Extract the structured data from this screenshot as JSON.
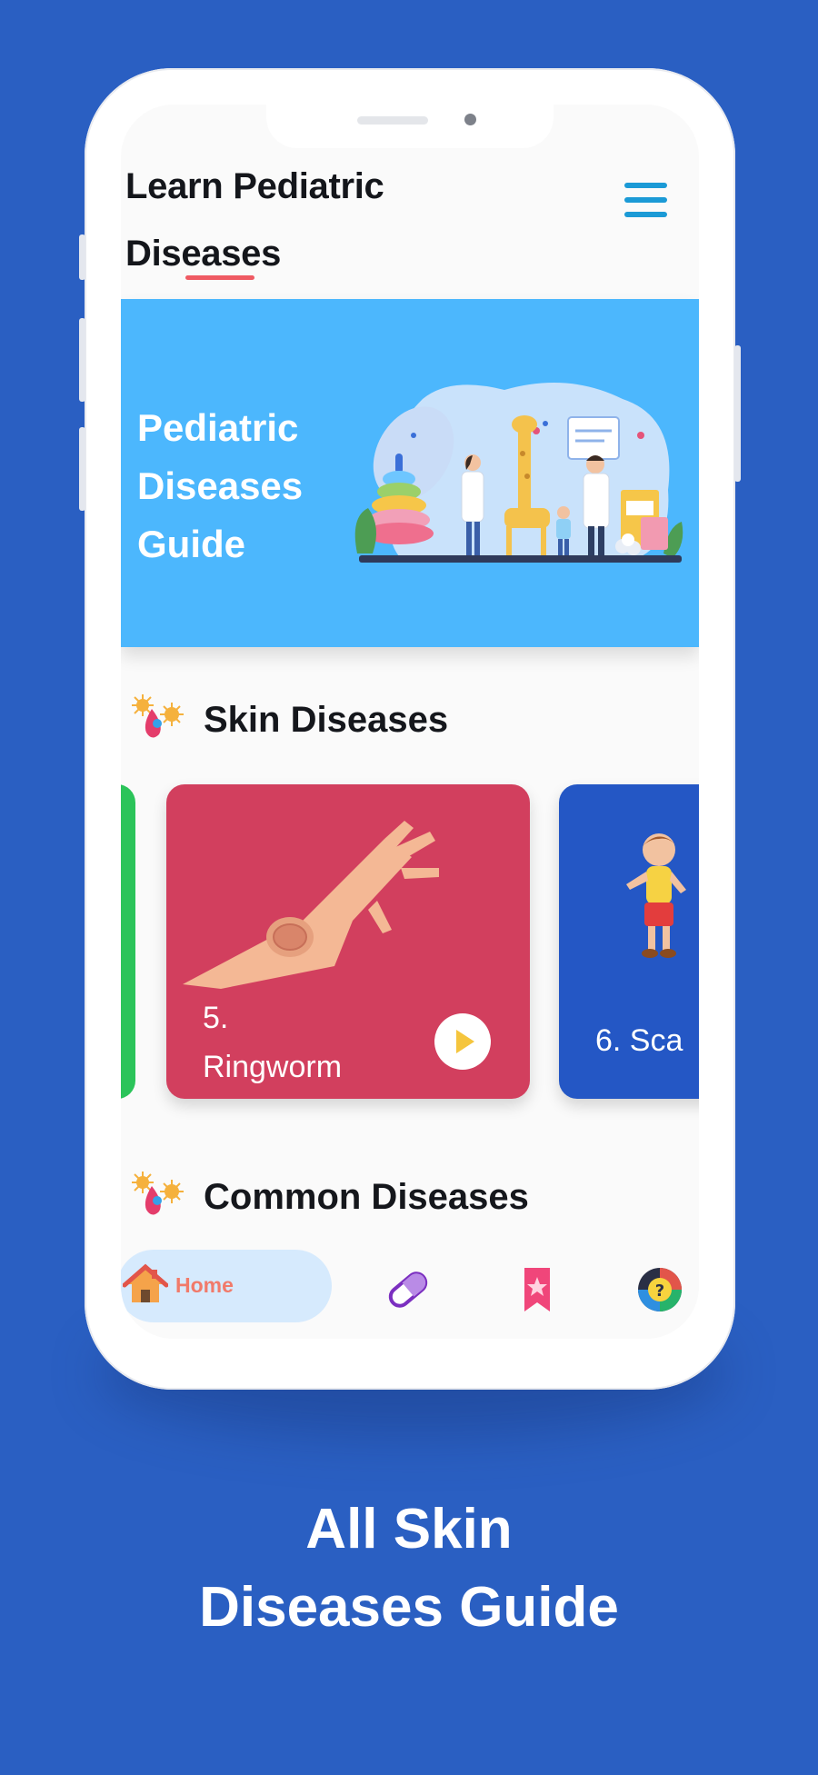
{
  "app": {
    "title": "Learn Pediatric Diseases",
    "title_line1": "Learn Pediatric",
    "title_line2": "Diseases"
  },
  "banner": {
    "line1": "Pediatric",
    "line2": "Diseases",
    "line3": "Guide"
  },
  "sections": [
    {
      "title": "Skin Diseases",
      "cards": [
        {
          "number": "5.",
          "title": "Ringworm",
          "color": "#d23f5e"
        },
        {
          "number": "6.",
          "title": "6. Sca",
          "color": "#2457c5"
        }
      ]
    },
    {
      "title": "Common Diseases"
    }
  ],
  "bottom_nav": {
    "items": [
      {
        "label": "Home",
        "icon": "home-icon",
        "active": true
      },
      {
        "label": "",
        "icon": "pill-icon"
      },
      {
        "label": "",
        "icon": "bookmark-icon"
      },
      {
        "label": "",
        "icon": "quiz-icon"
      }
    ]
  },
  "caption": {
    "line1": "All Skin",
    "line2": "Diseases Guide"
  },
  "colors": {
    "background": "#2a5fc2",
    "banner": "#4cb7fd",
    "accent": "#ef5a63",
    "menu": "#1b9ad6",
    "card_green": "#2bc45a"
  }
}
